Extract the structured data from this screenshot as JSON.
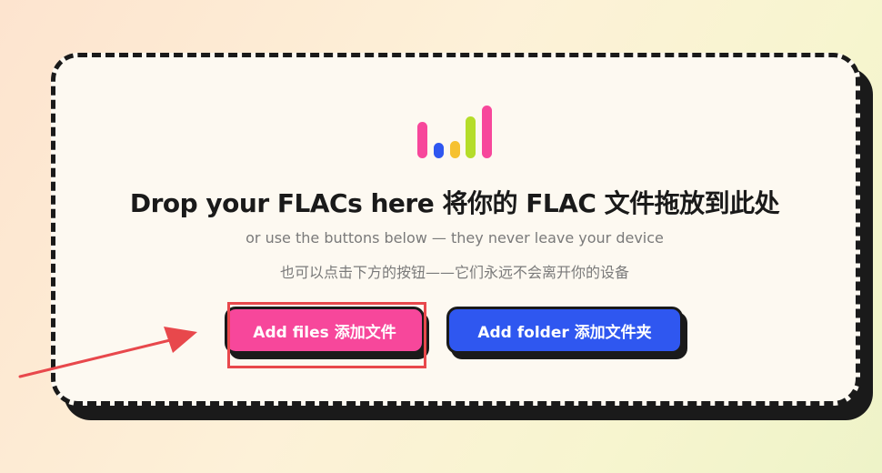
{
  "drop_zone": {
    "headline": "Drop your FLACs here 将你的 FLAC 文件拖放到此处",
    "subtitle_en": "or use the buttons below — they never leave your device",
    "subtitle_zh": "也可以点击下方的按钮——它们永远不会离开你的设备",
    "logo": {
      "icon": "audio-bars-icon",
      "bar_colors": [
        "#f7479b",
        "#2f57f0",
        "#f6c131",
        "#b5dd2a",
        "#f7479b"
      ]
    }
  },
  "actions": {
    "add_files_label": "Add files 添加文件",
    "add_folder_label": "Add folder 添加文件夹"
  },
  "colors": {
    "accent_pink": "#f7479b",
    "accent_blue": "#2f57f0",
    "annotation_red": "#e8484c",
    "card_bg": "#fdf9f1",
    "ink": "#1a1a1a"
  }
}
